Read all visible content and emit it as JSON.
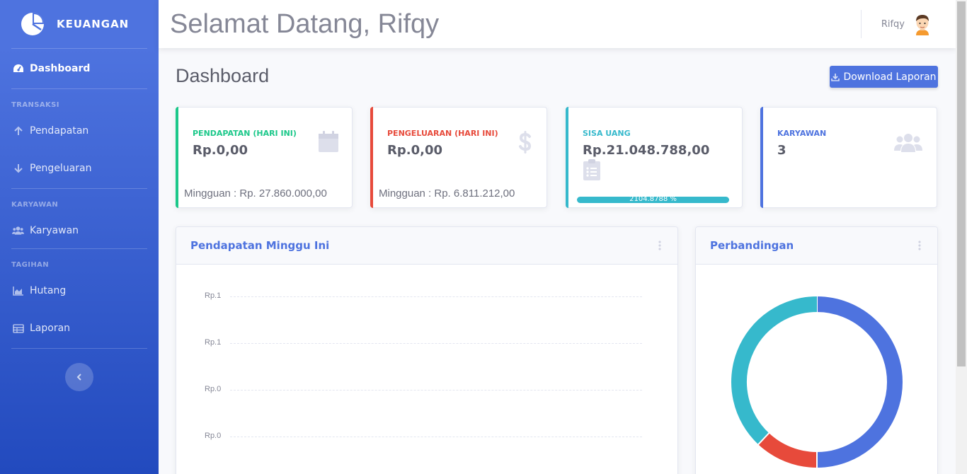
{
  "brand": {
    "name": "KEUANGAN",
    "icon": "pie-chart-logo-icon"
  },
  "sidebar": {
    "dashboard": {
      "label": "Dashboard",
      "icon": "tachometer-icon"
    },
    "sections": [
      {
        "heading": "TRANSAKSI",
        "items": [
          {
            "label": "Pendapatan",
            "icon": "arrow-up-icon"
          },
          {
            "label": "Pengeluaran",
            "icon": "arrow-down-icon"
          }
        ]
      },
      {
        "heading": "KARYAWAN",
        "items": [
          {
            "label": "Karyawan",
            "icon": "users-icon"
          }
        ]
      },
      {
        "heading": "TAGIHAN",
        "items": [
          {
            "label": "Hutang",
            "icon": "area-chart-icon"
          },
          {
            "label": "Laporan",
            "icon": "table-icon"
          }
        ]
      }
    ]
  },
  "topbar": {
    "welcome": "Selamat Datang, Rifqy",
    "user_name": "Rifqy"
  },
  "page": {
    "title": "Dashboard",
    "download_label": "Download Laporan"
  },
  "cards": [
    {
      "label": "PENDAPATAN (HARI INI)",
      "value": "Rp.0,00",
      "sub": "Mingguan : Rp. 27.860.000,00",
      "color": "#1cc88a",
      "icon": "calendar-icon"
    },
    {
      "label": "PENGELUARAN (HARI INI)",
      "value": "Rp.0,00",
      "sub": "Mingguan : Rp. 6.811.212,00",
      "color": "#e74a3b",
      "icon": "dollar-icon"
    },
    {
      "label": "SISA UANG",
      "value": "Rp.21.048.788,00",
      "progress_label": "2104.8788 %",
      "progress": 1.0,
      "color": "#36b9cc",
      "icon": "clipboard-list-icon"
    },
    {
      "label": "KARYAWAN",
      "value": "3",
      "color": "#4e73df",
      "icon": "users-icon"
    }
  ],
  "panels": {
    "area": {
      "title": "Pendapatan Minggu Ini"
    },
    "pie": {
      "title": "Perbandingan"
    }
  },
  "chart_data": [
    {
      "type": "area",
      "title": "Pendapatan Minggu Ini",
      "y_tick_labels": [
        "Rp.1",
        "Rp.1",
        "Rp.0",
        "Rp.0"
      ],
      "grid": true
    },
    {
      "type": "pie",
      "title": "Perbandingan",
      "donut": true,
      "slices": [
        {
          "value": 50,
          "color": "#4e73df"
        },
        {
          "value": 12,
          "color": "#e74a3b"
        },
        {
          "value": 38,
          "color": "#36b9cc"
        }
      ]
    }
  ]
}
